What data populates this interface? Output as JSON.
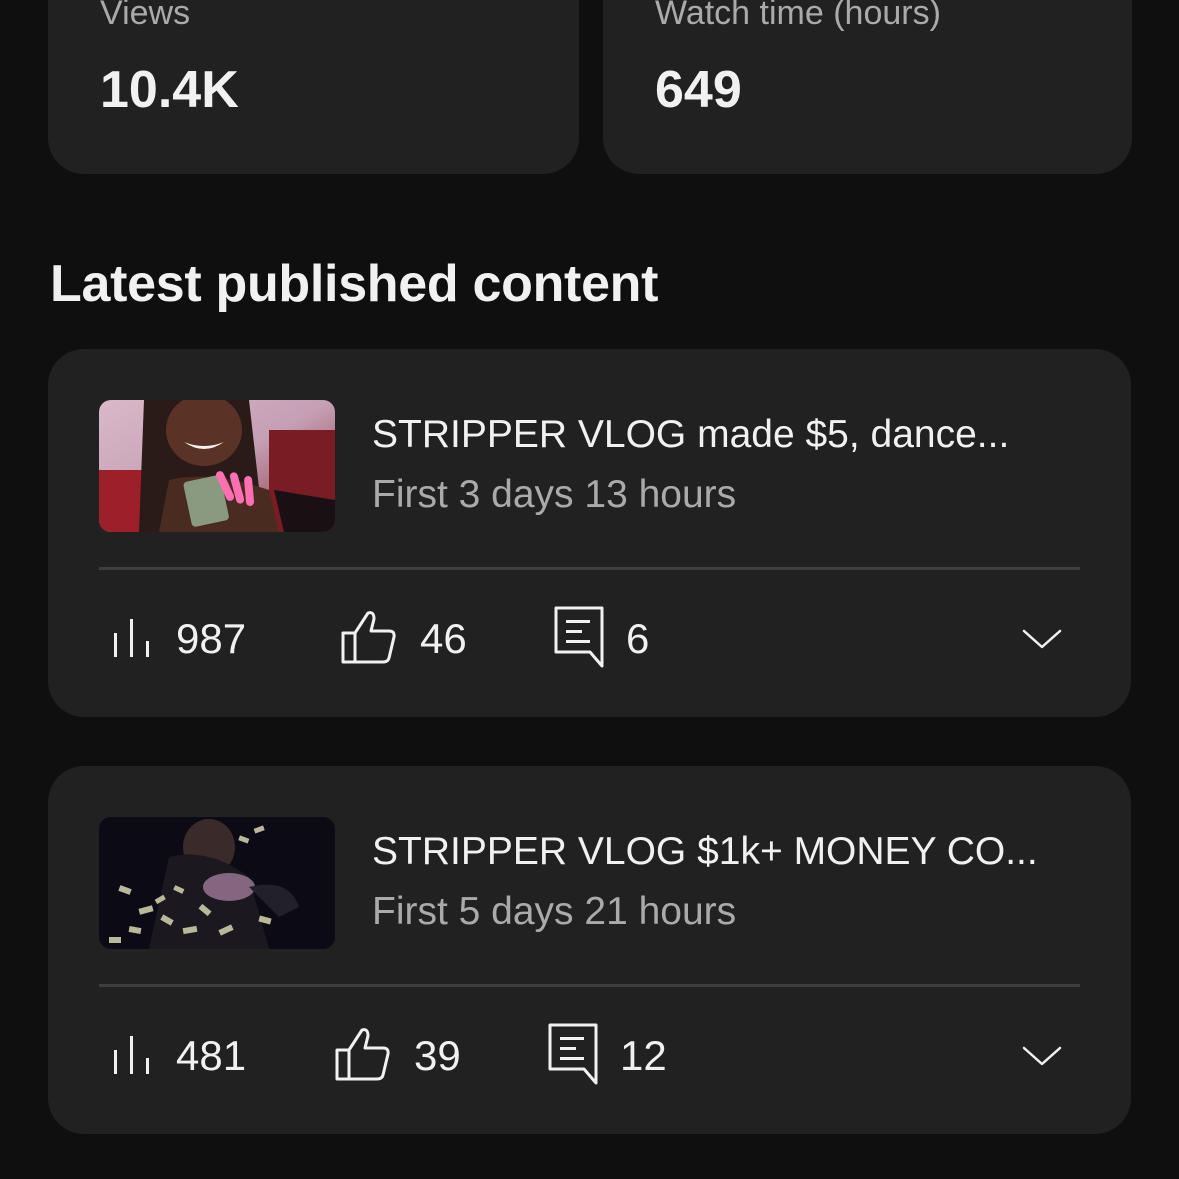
{
  "stats": {
    "views": {
      "label": "Views",
      "value": "10.4K"
    },
    "watch_time": {
      "label": "Watch time (hours)",
      "value": "649"
    }
  },
  "latest": {
    "title": "Latest published content",
    "items": [
      {
        "title": "STRIPPER VLOG made $5, dance...",
        "subtitle": "First 3 days 13 hours",
        "views": "987",
        "likes": "46",
        "comments": "6"
      },
      {
        "title": "STRIPPER VLOG $1k+ MONEY CO...",
        "subtitle": "First 5 days 21 hours",
        "views": "481",
        "likes": "39",
        "comments": "12"
      }
    ]
  },
  "icons": {
    "views": "bar-chart-icon",
    "likes": "thumbs-up-icon",
    "comments": "comment-icon",
    "expand": "chevron-down-icon"
  },
  "colors": {
    "background": "#0f0f0f",
    "card": "#212121",
    "text_primary": "#f1f1f1",
    "text_secondary": "#aaaaaa",
    "divider": "#3e3e3e"
  }
}
